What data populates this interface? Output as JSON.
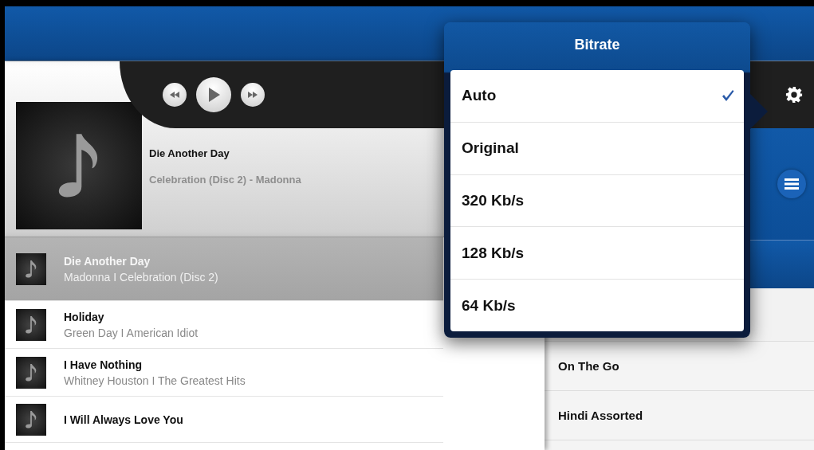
{
  "player": {
    "title": "Die Another Day",
    "subtitle": "Celebration (Disc 2) - Madonna"
  },
  "tracks": [
    {
      "title": "Die Another Day",
      "subtitle": "Madonna I Celebration (Disc 2)",
      "selected": true
    },
    {
      "title": "Holiday",
      "subtitle": "Green Day I American Idiot",
      "selected": false
    },
    {
      "title": "I Have Nothing",
      "subtitle": "Whitney Houston I The Greatest Hits",
      "selected": false
    },
    {
      "title": "I Will Always Love You",
      "selected": false
    }
  ],
  "playlists": [
    {
      "name": "On The Go"
    },
    {
      "name": "Hindi Assorted"
    }
  ],
  "bitrate_menu": {
    "title": "Bitrate",
    "options": [
      {
        "label": "Auto",
        "selected": true
      },
      {
        "label": "Original",
        "selected": false
      },
      {
        "label": "320 Kb/s",
        "selected": false
      },
      {
        "label": "128 Kb/s",
        "selected": false
      },
      {
        "label": "64 Kb/s",
        "selected": false
      }
    ]
  }
}
